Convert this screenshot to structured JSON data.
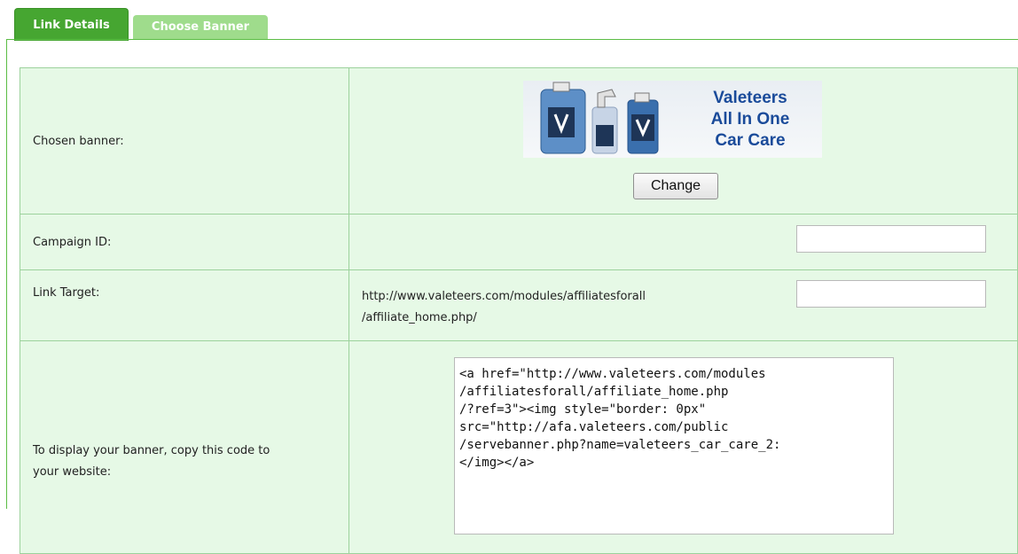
{
  "tabs": [
    {
      "label": "Link Details",
      "active": true
    },
    {
      "label": "Choose Banner",
      "active": false
    }
  ],
  "rows": {
    "banner": {
      "label": "Chosen banner:",
      "banner_text": [
        "Valeteers",
        "All In One",
        "Car Care"
      ],
      "change_button": "Change"
    },
    "campaign": {
      "label": "Campaign ID:",
      "input_value": ""
    },
    "target": {
      "label": "Link Target:",
      "url_line1": "http://www.valeteers.com/modules/affiliatesforall",
      "url_line2": "/affiliate_home.php/",
      "input_value": ""
    },
    "code": {
      "label_line1": "To display your banner, copy this code to",
      "label_line2": "your website:",
      "code": "<a href=\"http://www.valeteers.com/modules\n/affiliatesforall/affiliate_home.php\n/?ref=3\"><img style=\"border: 0px\"\nsrc=\"http://afa.valeteers.com/public\n/servebanner.php?name=valeteers_car_care_2:\n</img></a>"
    }
  },
  "colors": {
    "tab_active": "#46a631",
    "tab_inactive": "#9fdc8c",
    "table_bg": "#e6f9e6",
    "banner_text": "#1a4b9a"
  }
}
